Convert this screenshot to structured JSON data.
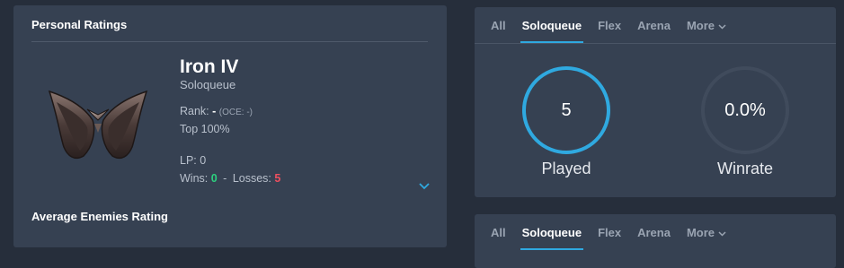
{
  "personal_ratings": {
    "title": "Personal Ratings",
    "tier": "Iron IV",
    "queue": "Soloqueue",
    "rank_label": "Rank:",
    "rank_value": "-",
    "rank_server": "(OCE: -)",
    "top": "Top 100%",
    "lp": "LP: 0",
    "wins_label": "Wins:",
    "wins_value": "0",
    "separator": "-",
    "losses_label": "Losses:",
    "losses_value": "5",
    "expand_icon": "chevron-down-icon",
    "emblem_icon": "iron-rank-emblem"
  },
  "average_enemies": {
    "title": "Average Enemies Rating"
  },
  "queue_tabs_top": {
    "tabs": [
      "All",
      "Soloqueue",
      "Flex",
      "Arena"
    ],
    "more": "More",
    "active": "Soloqueue"
  },
  "stats": {
    "played_value": "5",
    "played_label": "Played",
    "winrate_value": "0.0%",
    "winrate_label": "Winrate",
    "played_fraction": 1.0,
    "winrate_fraction": 0.0
  },
  "queue_tabs_bottom": {
    "tabs": [
      "All",
      "Soloqueue",
      "Flex",
      "Arena"
    ],
    "more": "More",
    "active": "Soloqueue"
  },
  "colors": {
    "accent": "#2fa9e0",
    "wins": "#2dd07f",
    "losses": "#ee4f5f",
    "panel": "#364152",
    "background": "#262e3b"
  }
}
